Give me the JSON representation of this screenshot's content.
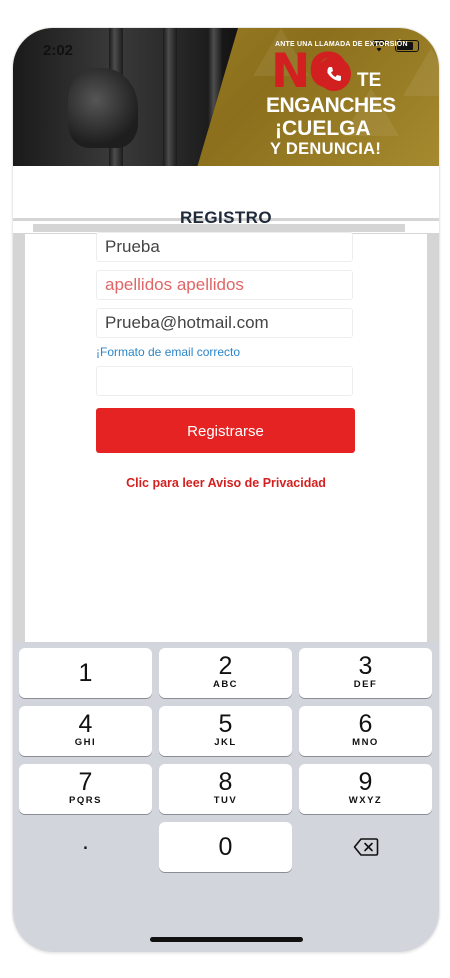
{
  "status_bar": {
    "time": "2:02"
  },
  "banner": {
    "top_text": "ANTE UNA LLAMADA DE EXTORSIÓN",
    "no": "NO",
    "te": "TE",
    "line1": "ENGANCHES",
    "line2": "¡CUELGA",
    "line3": "Y DENUNCIA!",
    "colors": {
      "gold": "#a08426",
      "red": "#d21f1f"
    }
  },
  "form": {
    "title": "REGISTRO",
    "name_value": "Prueba",
    "lastname_value": "apellidos apellidos",
    "email_value": "Prueba@hotmail.com",
    "email_hint": "¡Formato de email correcto",
    "phone_value": "",
    "register_button": "Registrarse",
    "privacy_link": "Clic para leer Aviso de Privacidad",
    "colors": {
      "button": "#e52323",
      "hint": "#2a86c8",
      "link": "#d42020"
    }
  },
  "keypad": {
    "keys": [
      {
        "num": "1",
        "letters": ""
      },
      {
        "num": "2",
        "letters": "ABC"
      },
      {
        "num": "3",
        "letters": "DEF"
      },
      {
        "num": "4",
        "letters": "GHI"
      },
      {
        "num": "5",
        "letters": "JKL"
      },
      {
        "num": "6",
        "letters": "MNO"
      },
      {
        "num": "7",
        "letters": "PQRS"
      },
      {
        "num": "8",
        "letters": "TUV"
      },
      {
        "num": "9",
        "letters": "WXYZ"
      },
      {
        "num": "0",
        "letters": ""
      }
    ],
    "dot": ".",
    "delete_icon": "backspace-icon"
  }
}
